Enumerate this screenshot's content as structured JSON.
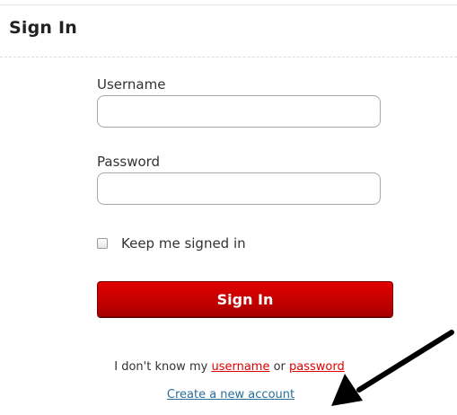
{
  "header": {
    "title": "Sign In"
  },
  "form": {
    "username": {
      "label": "Username",
      "value": "",
      "placeholder": ""
    },
    "password": {
      "label": "Password",
      "value": "",
      "placeholder": ""
    },
    "remember": {
      "label": "Keep me signed in",
      "checked": false
    },
    "submit_label": "Sign In"
  },
  "help": {
    "forgot_prefix": "I don't know my ",
    "username_link": "username",
    "or_text": " or ",
    "password_link": "password",
    "create_account": "Create a new account"
  },
  "annotation": {
    "icon": "arrow-icon"
  },
  "colors": {
    "button": "#c40000",
    "forgot_link": "#e00000",
    "create_link": "#2a6f9a"
  }
}
